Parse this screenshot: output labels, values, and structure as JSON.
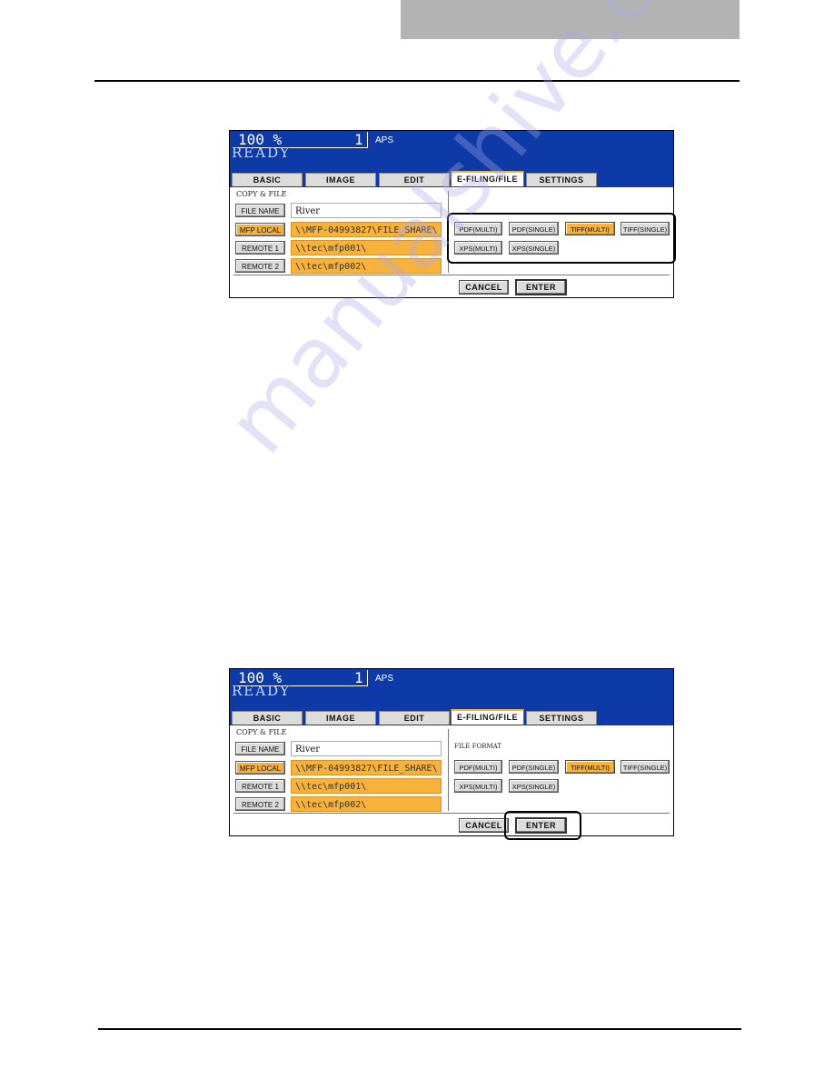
{
  "page": {
    "watermark": "manualshive.com"
  },
  "screens": [
    {
      "status": {
        "zoom": "100 %",
        "count": "1",
        "paper": "APS",
        "state": "READY"
      },
      "tabs": [
        "BASIC",
        "IMAGE",
        "EDIT",
        "E-FILING/FILE",
        "SETTINGS"
      ],
      "active_tab": "E-FILING/FILE",
      "section_label": "COPY & FILE",
      "rows": [
        {
          "button": "FILE NAME",
          "value": "River",
          "selected": false
        },
        {
          "button": "MFP LOCAL",
          "value": "\\\\MFP-04993827\\FILE_SHARE\\",
          "selected": true
        },
        {
          "button": "REMOTE 1",
          "value": "\\\\tec\\mfp001\\",
          "selected": false
        },
        {
          "button": "REMOTE 2",
          "value": "\\\\tec\\mfp002\\",
          "selected": false
        }
      ],
      "file_format_label": "",
      "formats": [
        {
          "label": "PDF(MULTI)",
          "selected": false
        },
        {
          "label": "PDF(SINGLE)",
          "selected": false
        },
        {
          "label": "TIFF(MULTI)",
          "selected": true
        },
        {
          "label": "TIFF(SINGLE)",
          "selected": false
        },
        {
          "label": "XPS(MULTI)",
          "selected": false
        },
        {
          "label": "XPS(SINGLE)",
          "selected": false
        }
      ],
      "cancel_label": "CANCEL",
      "enter_label": "ENTER",
      "highlighted": "file-format-buttons"
    },
    {
      "status": {
        "zoom": "100 %",
        "count": "1",
        "paper": "APS",
        "state": "READY"
      },
      "tabs": [
        "BASIC",
        "IMAGE",
        "EDIT",
        "E-FILING/FILE",
        "SETTINGS"
      ],
      "active_tab": "E-FILING/FILE",
      "section_label": "COPY & FILE",
      "rows": [
        {
          "button": "FILE NAME",
          "value": "River",
          "selected": false
        },
        {
          "button": "MFP LOCAL",
          "value": "\\\\MFP-04993827\\FILE_SHARE\\",
          "selected": true
        },
        {
          "button": "REMOTE 1",
          "value": "\\\\tec\\mfp001\\",
          "selected": false
        },
        {
          "button": "REMOTE 2",
          "value": "\\\\tec\\mfp002\\",
          "selected": false
        }
      ],
      "file_format_label": "FILE FORMAT",
      "formats": [
        {
          "label": "PDF(MULTI)",
          "selected": false
        },
        {
          "label": "PDF(SINGLE)",
          "selected": false
        },
        {
          "label": "TIFF(MULTI)",
          "selected": true
        },
        {
          "label": "TIFF(SINGLE)",
          "selected": false
        },
        {
          "label": "XPS(MULTI)",
          "selected": false
        },
        {
          "label": "XPS(SINGLE)",
          "selected": false
        }
      ],
      "cancel_label": "CANCEL",
      "enter_label": "ENTER",
      "highlighted": "enter-button"
    }
  ],
  "colors": {
    "screen_blue": "#0e3aa8",
    "selected_orange": "#f7b23b",
    "button_gray": "#dcdcdc",
    "header_gray": "#b3b3b3"
  }
}
